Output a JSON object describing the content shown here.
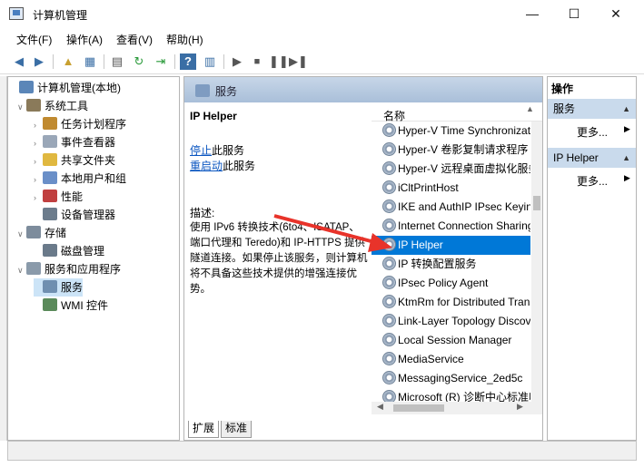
{
  "window": {
    "title": "计算机管理",
    "min": "—",
    "max": "☐",
    "close": "✕"
  },
  "menu": [
    "文件(F)",
    "操作(A)",
    "查看(V)",
    "帮助(H)"
  ],
  "tree": [
    {
      "label": "计算机管理(本地)",
      "icon": "computer-mgmt-icon",
      "indent": 0,
      "twisty": ""
    },
    {
      "label": "系统工具",
      "icon": "tools-icon",
      "indent": 1,
      "twisty": "∨"
    },
    {
      "label": "任务计划程序",
      "icon": "clock-icon",
      "indent": 2,
      "twisty": "›"
    },
    {
      "label": "事件查看器",
      "icon": "event-viewer-icon",
      "indent": 2,
      "twisty": "›"
    },
    {
      "label": "共享文件夹",
      "icon": "shared-folder-icon",
      "indent": 2,
      "twisty": "›"
    },
    {
      "label": "本地用户和组",
      "icon": "users-icon",
      "indent": 2,
      "twisty": "›"
    },
    {
      "label": "性能",
      "icon": "performance-icon",
      "indent": 2,
      "twisty": "›"
    },
    {
      "label": "设备管理器",
      "icon": "device-manager-icon",
      "indent": 2,
      "twisty": ""
    },
    {
      "label": "存储",
      "icon": "storage-icon",
      "indent": 1,
      "twisty": "∨"
    },
    {
      "label": "磁盘管理",
      "icon": "disk-icon",
      "indent": 2,
      "twisty": ""
    },
    {
      "label": "服务和应用程序",
      "icon": "services-apps-icon",
      "indent": 1,
      "twisty": "∨"
    },
    {
      "label": "服务",
      "icon": "services-icon",
      "indent": 2,
      "twisty": "",
      "selected": true
    },
    {
      "label": "WMI 控件",
      "icon": "wmi-icon",
      "indent": 2,
      "twisty": ""
    }
  ],
  "center": {
    "title": "服务",
    "service_name": "IP Helper",
    "stop_link": "停止",
    "stop_suffix": "此服务",
    "restart_link": "重启动",
    "restart_suffix": "此服务",
    "desc_label": "描述:",
    "desc_body": "使用 IPv6 转换技术(6to4、ISATAP、端口代理和 Teredo)和 IP-HTTPS 提供隧道连接。如果停止该服务，则计算机将不具备这些技术提供的增强连接优势。",
    "column_name": "名称",
    "tab_extended": "扩展",
    "tab_standard": "标准"
  },
  "services": [
    {
      "name": "Hyper-V Time Synchronization Service"
    },
    {
      "name": "Hyper-V 卷影复制请求程序"
    },
    {
      "name": "Hyper-V 远程桌面虚拟化服务"
    },
    {
      "name": "iCltPrintHost"
    },
    {
      "name": "IKE and AuthIP IPsec Keying Modules"
    },
    {
      "name": "Internet Connection Sharing (ICS)"
    },
    {
      "name": "IP Helper",
      "selected": true
    },
    {
      "name": "IP 转换配置服务"
    },
    {
      "name": "IPsec Policy Agent"
    },
    {
      "name": "KtmRm for Distributed Transaction Coordinator"
    },
    {
      "name": "Link-Layer Topology Discovery Mapper"
    },
    {
      "name": "Local Session Manager"
    },
    {
      "name": "MediaService"
    },
    {
      "name": "MessagingService_2ed5c"
    },
    {
      "name": "Microsoft (R) 诊断中心标准收集器服务"
    }
  ],
  "actions": {
    "title": "操作",
    "groups": [
      {
        "header": "服务",
        "more": "更多..."
      },
      {
        "header": "IP Helper",
        "more": "更多..."
      }
    ]
  },
  "colors": {
    "selection": "#0078d7",
    "arrow": "#e8332a",
    "header": "#c9daec"
  }
}
